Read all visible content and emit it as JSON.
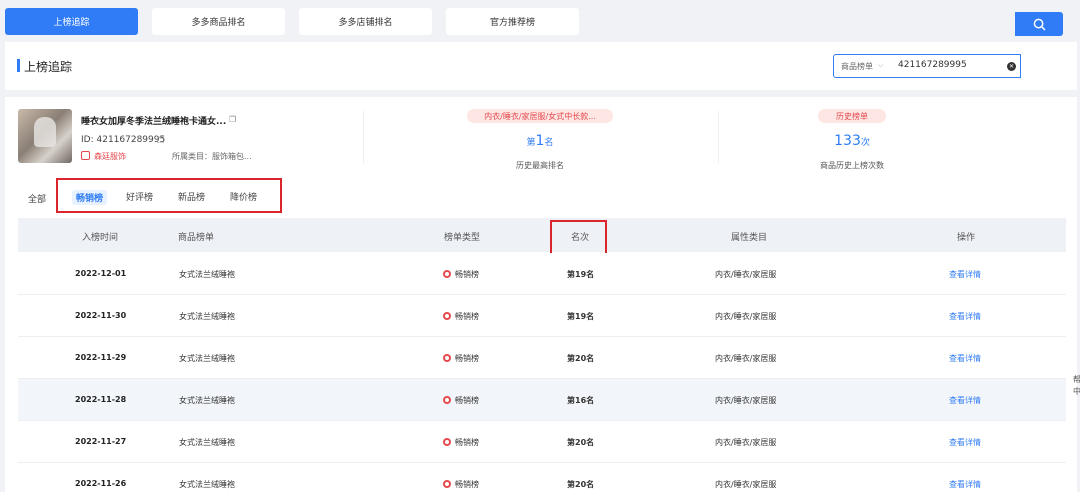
{
  "top_tabs": [
    {
      "label": "上榜追踪",
      "active": true
    },
    {
      "label": "多多商品排名",
      "active": false
    },
    {
      "label": "多多店铺排名",
      "active": false
    },
    {
      "label": "官方推荐榜",
      "active": false
    }
  ],
  "header": {
    "title": "上榜追踪",
    "search": {
      "type_label": "商品榜单",
      "value": "421167289995"
    }
  },
  "product": {
    "title": "睡衣女加厚冬季法兰绒睡袍卡通女...",
    "id_label": "ID:",
    "id": "421167289995",
    "shop": "森廷服饰",
    "category": "所属类目：服饰箱包..."
  },
  "stats": {
    "category_pill": "内衣/睡衣/家居服/女式中长款...",
    "best_rank_prefix": "第",
    "best_rank_value": "1",
    "best_rank_suffix": "名",
    "best_rank_label": "历史最高排名",
    "history_pill": "历史榜单",
    "history_count": "133",
    "history_count_suffix": "次",
    "history_label": "商品历史上榜次数"
  },
  "sub_tabs": {
    "all": "全部",
    "items": [
      {
        "label": "畅销榜",
        "active": true
      },
      {
        "label": "好评榜",
        "active": false
      },
      {
        "label": "新品榜",
        "active": false
      },
      {
        "label": "降价榜",
        "active": false
      }
    ]
  },
  "table": {
    "headers": [
      "入榜时间",
      "商品榜单",
      "榜单类型",
      "名次",
      "属性类目",
      "操作"
    ],
    "rows": [
      {
        "date": "2022-12-01",
        "list": "女式法兰绒睡袍",
        "type": "畅销榜",
        "rank": "第19名",
        "category": "内衣/睡衣/家居服",
        "action": "查看详情"
      },
      {
        "date": "2022-11-30",
        "list": "女式法兰绒睡袍",
        "type": "畅销榜",
        "rank": "第19名",
        "category": "内衣/睡衣/家居服",
        "action": "查看详情"
      },
      {
        "date": "2022-11-29",
        "list": "女式法兰绒睡袍",
        "type": "畅销榜",
        "rank": "第20名",
        "category": "内衣/睡衣/家居服",
        "action": "查看详情"
      },
      {
        "date": "2022-11-28",
        "list": "女式法兰绒睡袍",
        "type": "畅销榜",
        "rank": "第16名",
        "category": "内衣/睡衣/家居服",
        "action": "查看详情"
      },
      {
        "date": "2022-11-27",
        "list": "女式法兰绒睡袍",
        "type": "畅销榜",
        "rank": "第20名",
        "category": "内衣/睡衣/家居服",
        "action": "查看详情"
      },
      {
        "date": "2022-11-26",
        "list": "女式法兰绒睡袍",
        "type": "畅销榜",
        "rank": "第20名",
        "category": "内衣/睡衣/家居服",
        "action": "查看详情"
      }
    ]
  },
  "edge_fragments": [
    "帮",
    "中"
  ],
  "colors": {
    "accent": "#2f7cf6",
    "highlight_box": "#d9252b",
    "tag_red": "#e5484d"
  }
}
